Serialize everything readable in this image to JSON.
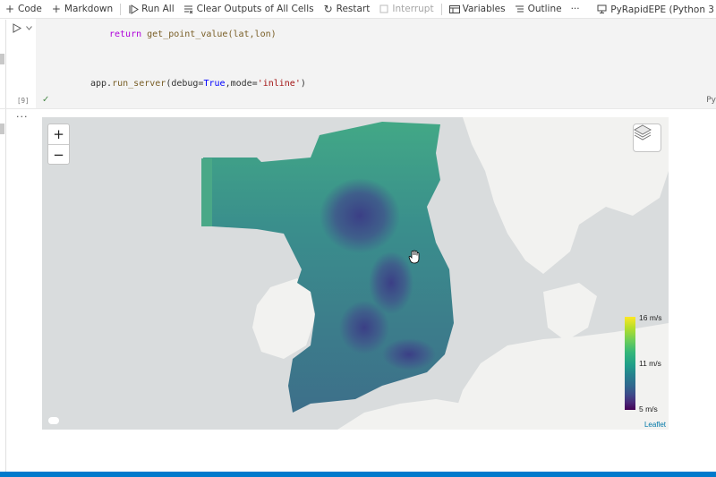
{
  "toolbar": {
    "code_label": "Code",
    "markdown_label": "Markdown",
    "run_all_label": "Run All",
    "clear_outputs_label": "Clear Outputs of All Cells",
    "restart_label": "Restart",
    "interrupt_label": "Interrupt",
    "variables_label": "Variables",
    "outline_label": "Outline",
    "more_label": "···",
    "kernel_label": "PyRapidEPE (Python 3"
  },
  "cell": {
    "line1_keyword": "return",
    "line1_rest": " get_point_value(lat,lon)",
    "line2_obj": "app.",
    "line2_fn": "run_server",
    "line2_args_a": "(debug=",
    "line2_true": "True",
    "line2_args_b": ",mode=",
    "line2_str": "'inline'",
    "line2_close": ")",
    "execution_count": "[9]",
    "language": "Py",
    "output_ellipsis": "···"
  },
  "map": {
    "zoom_in_label": "+",
    "zoom_out_label": "−",
    "legend": {
      "max_label": "16 m/s",
      "mid_label": "11 m/s",
      "min_label": "5 m/s",
      "max_value": 16,
      "mid_value": 11,
      "min_value": 5
    },
    "attribution": "Leaflet",
    "colormap_top": "#fde725",
    "colormap_bottom": "#440154",
    "land_color": "#f2f2f0",
    "sea_color": "#d9dcdd"
  },
  "colors": {
    "status_bar": "#007acc",
    "toolbar_bg": "#ffffff",
    "cell_bg": "#f3f3f3"
  }
}
